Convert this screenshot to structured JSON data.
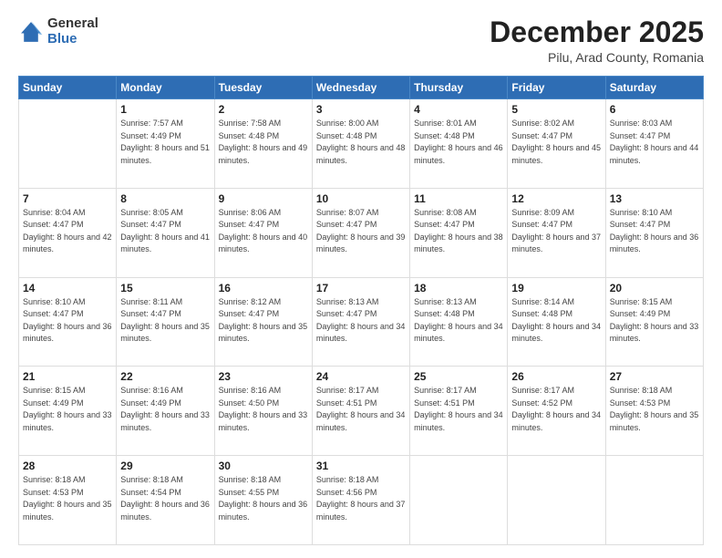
{
  "logo": {
    "general": "General",
    "blue": "Blue"
  },
  "header": {
    "title": "December 2025",
    "subtitle": "Pilu, Arad County, Romania"
  },
  "weekdays": [
    "Sunday",
    "Monday",
    "Tuesday",
    "Wednesday",
    "Thursday",
    "Friday",
    "Saturday"
  ],
  "weeks": [
    [
      {
        "day": "",
        "sunrise": "",
        "sunset": "",
        "daylight": ""
      },
      {
        "day": "1",
        "sunrise": "Sunrise: 7:57 AM",
        "sunset": "Sunset: 4:49 PM",
        "daylight": "Daylight: 8 hours and 51 minutes."
      },
      {
        "day": "2",
        "sunrise": "Sunrise: 7:58 AM",
        "sunset": "Sunset: 4:48 PM",
        "daylight": "Daylight: 8 hours and 49 minutes."
      },
      {
        "day": "3",
        "sunrise": "Sunrise: 8:00 AM",
        "sunset": "Sunset: 4:48 PM",
        "daylight": "Daylight: 8 hours and 48 minutes."
      },
      {
        "day": "4",
        "sunrise": "Sunrise: 8:01 AM",
        "sunset": "Sunset: 4:48 PM",
        "daylight": "Daylight: 8 hours and 46 minutes."
      },
      {
        "day": "5",
        "sunrise": "Sunrise: 8:02 AM",
        "sunset": "Sunset: 4:47 PM",
        "daylight": "Daylight: 8 hours and 45 minutes."
      },
      {
        "day": "6",
        "sunrise": "Sunrise: 8:03 AM",
        "sunset": "Sunset: 4:47 PM",
        "daylight": "Daylight: 8 hours and 44 minutes."
      }
    ],
    [
      {
        "day": "7",
        "sunrise": "Sunrise: 8:04 AM",
        "sunset": "Sunset: 4:47 PM",
        "daylight": "Daylight: 8 hours and 42 minutes."
      },
      {
        "day": "8",
        "sunrise": "Sunrise: 8:05 AM",
        "sunset": "Sunset: 4:47 PM",
        "daylight": "Daylight: 8 hours and 41 minutes."
      },
      {
        "day": "9",
        "sunrise": "Sunrise: 8:06 AM",
        "sunset": "Sunset: 4:47 PM",
        "daylight": "Daylight: 8 hours and 40 minutes."
      },
      {
        "day": "10",
        "sunrise": "Sunrise: 8:07 AM",
        "sunset": "Sunset: 4:47 PM",
        "daylight": "Daylight: 8 hours and 39 minutes."
      },
      {
        "day": "11",
        "sunrise": "Sunrise: 8:08 AM",
        "sunset": "Sunset: 4:47 PM",
        "daylight": "Daylight: 8 hours and 38 minutes."
      },
      {
        "day": "12",
        "sunrise": "Sunrise: 8:09 AM",
        "sunset": "Sunset: 4:47 PM",
        "daylight": "Daylight: 8 hours and 37 minutes."
      },
      {
        "day": "13",
        "sunrise": "Sunrise: 8:10 AM",
        "sunset": "Sunset: 4:47 PM",
        "daylight": "Daylight: 8 hours and 36 minutes."
      }
    ],
    [
      {
        "day": "14",
        "sunrise": "Sunrise: 8:10 AM",
        "sunset": "Sunset: 4:47 PM",
        "daylight": "Daylight: 8 hours and 36 minutes."
      },
      {
        "day": "15",
        "sunrise": "Sunrise: 8:11 AM",
        "sunset": "Sunset: 4:47 PM",
        "daylight": "Daylight: 8 hours and 35 minutes."
      },
      {
        "day": "16",
        "sunrise": "Sunrise: 8:12 AM",
        "sunset": "Sunset: 4:47 PM",
        "daylight": "Daylight: 8 hours and 35 minutes."
      },
      {
        "day": "17",
        "sunrise": "Sunrise: 8:13 AM",
        "sunset": "Sunset: 4:47 PM",
        "daylight": "Daylight: 8 hours and 34 minutes."
      },
      {
        "day": "18",
        "sunrise": "Sunrise: 8:13 AM",
        "sunset": "Sunset: 4:48 PM",
        "daylight": "Daylight: 8 hours and 34 minutes."
      },
      {
        "day": "19",
        "sunrise": "Sunrise: 8:14 AM",
        "sunset": "Sunset: 4:48 PM",
        "daylight": "Daylight: 8 hours and 34 minutes."
      },
      {
        "day": "20",
        "sunrise": "Sunrise: 8:15 AM",
        "sunset": "Sunset: 4:49 PM",
        "daylight": "Daylight: 8 hours and 33 minutes."
      }
    ],
    [
      {
        "day": "21",
        "sunrise": "Sunrise: 8:15 AM",
        "sunset": "Sunset: 4:49 PM",
        "daylight": "Daylight: 8 hours and 33 minutes."
      },
      {
        "day": "22",
        "sunrise": "Sunrise: 8:16 AM",
        "sunset": "Sunset: 4:49 PM",
        "daylight": "Daylight: 8 hours and 33 minutes."
      },
      {
        "day": "23",
        "sunrise": "Sunrise: 8:16 AM",
        "sunset": "Sunset: 4:50 PM",
        "daylight": "Daylight: 8 hours and 33 minutes."
      },
      {
        "day": "24",
        "sunrise": "Sunrise: 8:17 AM",
        "sunset": "Sunset: 4:51 PM",
        "daylight": "Daylight: 8 hours and 34 minutes."
      },
      {
        "day": "25",
        "sunrise": "Sunrise: 8:17 AM",
        "sunset": "Sunset: 4:51 PM",
        "daylight": "Daylight: 8 hours and 34 minutes."
      },
      {
        "day": "26",
        "sunrise": "Sunrise: 8:17 AM",
        "sunset": "Sunset: 4:52 PM",
        "daylight": "Daylight: 8 hours and 34 minutes."
      },
      {
        "day": "27",
        "sunrise": "Sunrise: 8:18 AM",
        "sunset": "Sunset: 4:53 PM",
        "daylight": "Daylight: 8 hours and 35 minutes."
      }
    ],
    [
      {
        "day": "28",
        "sunrise": "Sunrise: 8:18 AM",
        "sunset": "Sunset: 4:53 PM",
        "daylight": "Daylight: 8 hours and 35 minutes."
      },
      {
        "day": "29",
        "sunrise": "Sunrise: 8:18 AM",
        "sunset": "Sunset: 4:54 PM",
        "daylight": "Daylight: 8 hours and 36 minutes."
      },
      {
        "day": "30",
        "sunrise": "Sunrise: 8:18 AM",
        "sunset": "Sunset: 4:55 PM",
        "daylight": "Daylight: 8 hours and 36 minutes."
      },
      {
        "day": "31",
        "sunrise": "Sunrise: 8:18 AM",
        "sunset": "Sunset: 4:56 PM",
        "daylight": "Daylight: 8 hours and 37 minutes."
      },
      {
        "day": "",
        "sunrise": "",
        "sunset": "",
        "daylight": ""
      },
      {
        "day": "",
        "sunrise": "",
        "sunset": "",
        "daylight": ""
      },
      {
        "day": "",
        "sunrise": "",
        "sunset": "",
        "daylight": ""
      }
    ]
  ]
}
